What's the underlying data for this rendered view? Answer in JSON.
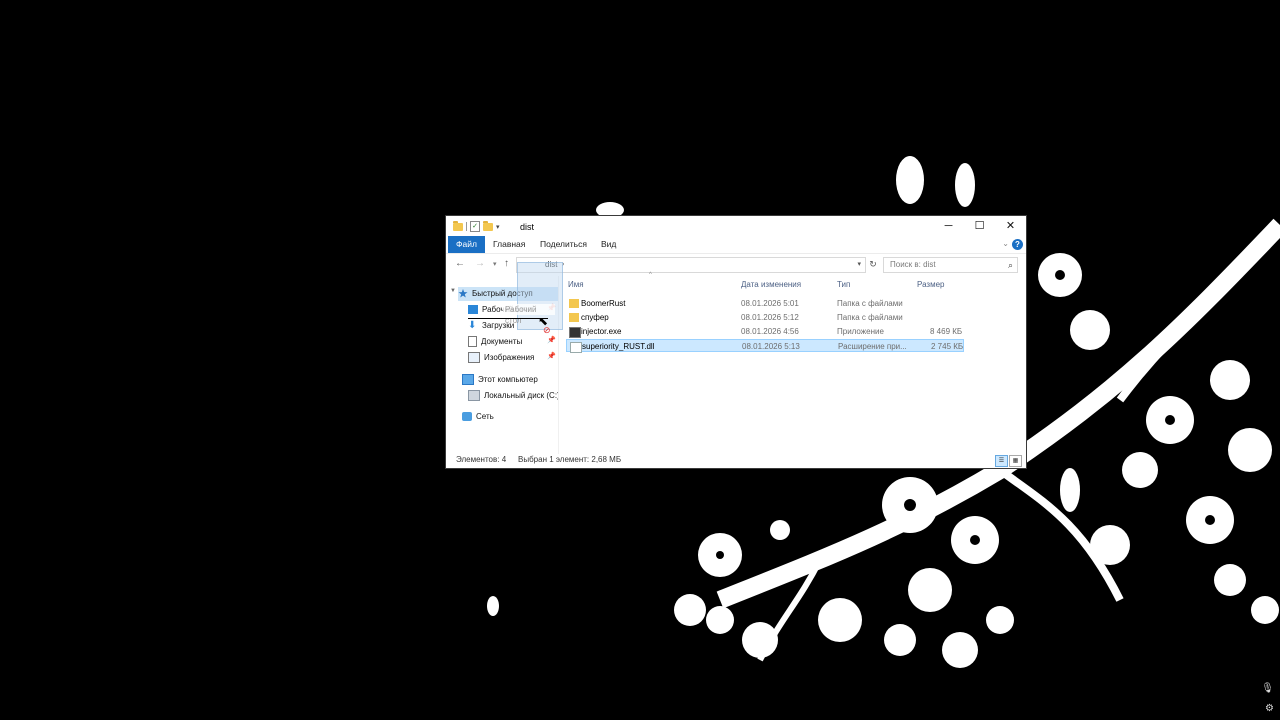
{
  "window": {
    "title": "dist",
    "controls": {
      "minimize": "─",
      "maximize": "☐",
      "close": "✕"
    }
  },
  "ribbon": {
    "tabs": [
      "Файл",
      "Главная",
      "Поделиться",
      "Вид"
    ],
    "help": "?"
  },
  "nav": {
    "breadcrumb": "dist",
    "search_placeholder": "Поиск в: dist"
  },
  "navpane": {
    "quick_access": "Быстрый доступ",
    "items": [
      {
        "label": "Рабочий стол",
        "icon": "desktop-icon"
      },
      {
        "label": "Загрузки",
        "icon": "downloads-icon"
      },
      {
        "label": "Документы",
        "icon": "documents-icon"
      },
      {
        "label": "Изображения",
        "icon": "pictures-icon"
      }
    ],
    "this_pc": "Этот компьютер",
    "local_disk": "Локальный диск (C:)",
    "network": "Сеть"
  },
  "columns": {
    "name": "Имя",
    "date": "Дата изменения",
    "type": "Тип",
    "size": "Размер"
  },
  "files": [
    {
      "name": "BoomerRust",
      "date": "08.01.2026 5:01",
      "type": "Папка с файлами",
      "size": "",
      "icon": "folder-icon"
    },
    {
      "name": "спуфер",
      "date": "08.01.2026 5:12",
      "type": "Папка с файлами",
      "size": "",
      "icon": "folder-icon"
    },
    {
      "name": "injector.exe",
      "date": "08.01.2026 4:56",
      "type": "Приложение",
      "size": "8 469 КБ",
      "icon": "exe-icon"
    },
    {
      "name": "superiority_RUST.dll",
      "date": "08.01.2026 5:13",
      "type": "Расширение при...",
      "size": "2 745 КБ",
      "icon": "dll-icon",
      "selected": true
    }
  ],
  "status": {
    "count": "Элементов: 4",
    "selection": "Выбран 1 элемент: 2,68 МБ"
  },
  "colors": {
    "accent": "#1a6fc4",
    "selection": "#cce8ff",
    "folder": "#f3c74f"
  }
}
